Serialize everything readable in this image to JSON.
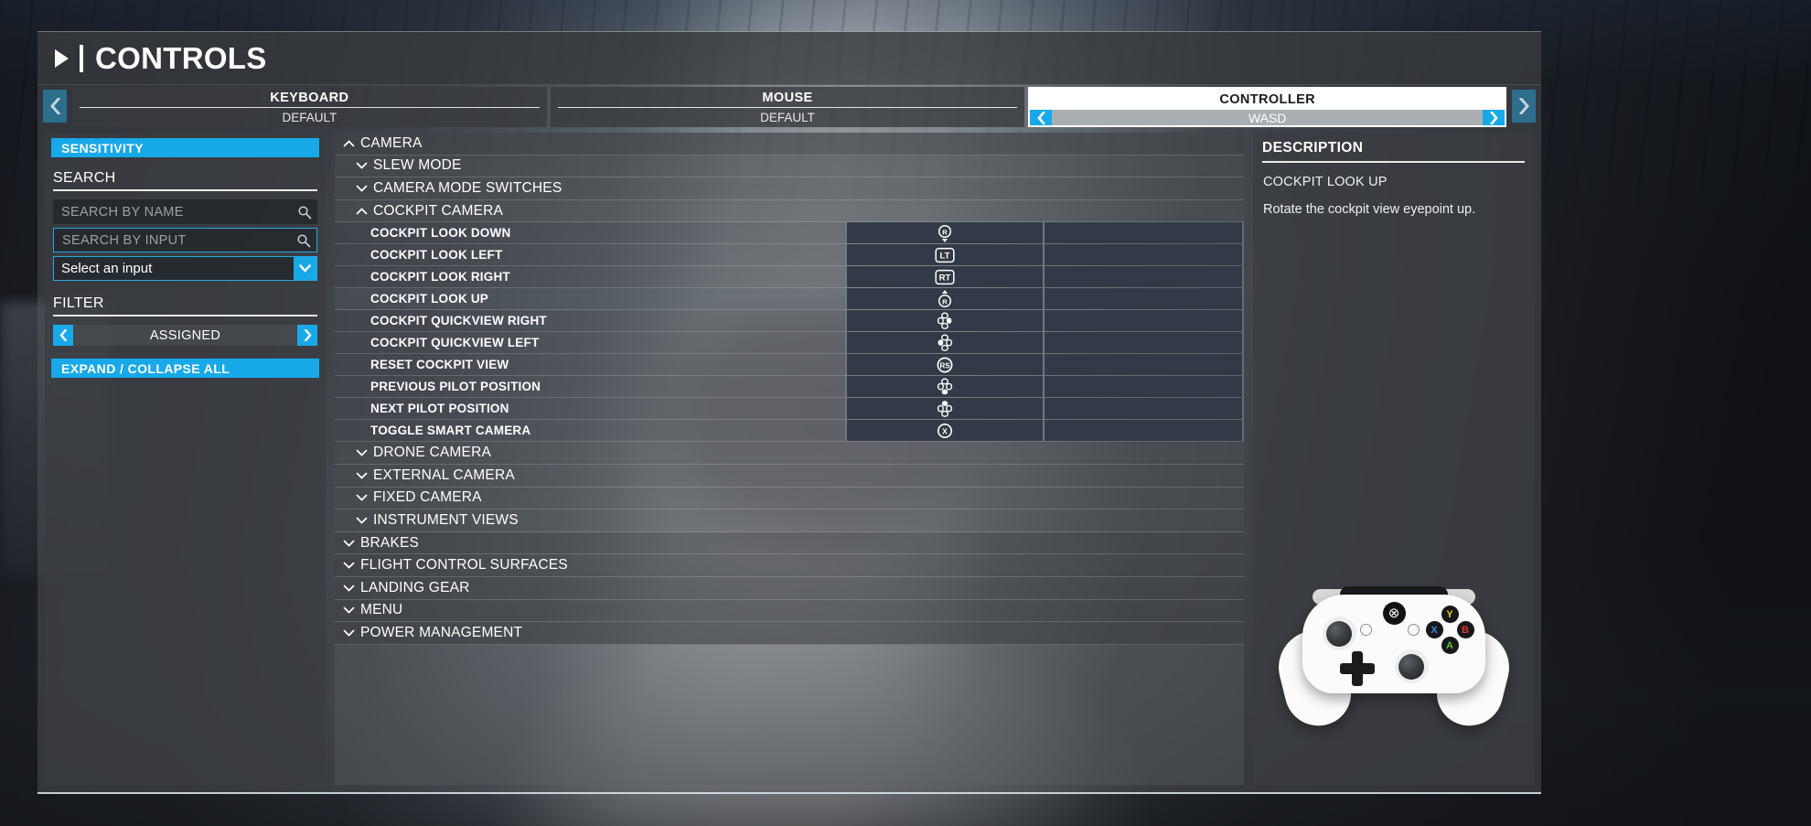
{
  "header": {
    "title": "CONTROLS",
    "arrow_icon": "chevron-right-icon",
    "nav_prev_icon": "chevron-left-icon",
    "nav_next_icon": "chevron-right-icon"
  },
  "tabs": [
    {
      "label": "KEYBOARD",
      "preset": "DEFAULT",
      "active": false
    },
    {
      "label": "MOUSE",
      "preset": "DEFAULT",
      "active": false
    },
    {
      "label": "CONTROLLER",
      "preset": "WASD",
      "active": true,
      "prev_icon": "chevron-left-icon",
      "next_icon": "chevron-right-icon"
    }
  ],
  "sidebar": {
    "sensitivity_label": "SENSITIVITY",
    "search": {
      "title": "SEARCH",
      "by_name_placeholder": "SEARCH BY NAME",
      "by_name_value": "",
      "by_input_placeholder": "SEARCH BY INPUT",
      "by_input_value": "",
      "select_input_value": "Select an input",
      "search_icon": "magnifier-icon",
      "caret_icon": "chevron-down-icon"
    },
    "filter": {
      "title": "FILTER",
      "value": "ASSIGNED",
      "prev_icon": "chevron-left-icon",
      "next_icon": "chevron-right-icon"
    },
    "expand_collapse_label": "EXPAND / COLLAPSE ALL"
  },
  "tree": [
    {
      "id": "camera",
      "label": "CAMERA",
      "level": 0,
      "type": "category",
      "expanded": true
    },
    {
      "id": "slew-mode",
      "label": "SLEW MODE",
      "level": 1,
      "type": "category",
      "expanded": false
    },
    {
      "id": "camera-mode-switches",
      "label": "CAMERA MODE SWITCHES",
      "level": 1,
      "type": "category",
      "expanded": false
    },
    {
      "id": "cockpit-camera",
      "label": "COCKPIT CAMERA",
      "level": 2,
      "type": "category",
      "expanded": true
    },
    {
      "id": "cockpit-look-down",
      "label": "COCKPIT LOOK DOWN",
      "type": "binding",
      "glyph": "rstick-down-icon",
      "selected": false
    },
    {
      "id": "cockpit-look-left",
      "label": "COCKPIT LOOK LEFT",
      "type": "binding",
      "glyph": "lt-trigger-icon",
      "selected": false
    },
    {
      "id": "cockpit-look-right",
      "label": "COCKPIT LOOK RIGHT",
      "type": "binding",
      "glyph": "rt-trigger-icon",
      "selected": false
    },
    {
      "id": "cockpit-look-up",
      "label": "COCKPIT LOOK UP",
      "type": "binding",
      "glyph": "rstick-up-icon",
      "selected": true
    },
    {
      "id": "cockpit-quickview-right",
      "label": "COCKPIT QUICKVIEW RIGHT",
      "type": "binding",
      "glyph": "dpad-right-icon",
      "selected": false
    },
    {
      "id": "cockpit-quickview-left",
      "label": "COCKPIT QUICKVIEW LEFT",
      "type": "binding",
      "glyph": "dpad-left-icon",
      "selected": false
    },
    {
      "id": "reset-cockpit-view",
      "label": "RESET COCKPIT VIEW",
      "type": "binding",
      "glyph": "rs-click-icon",
      "selected": false
    },
    {
      "id": "previous-pilot-position",
      "label": "PREVIOUS PILOT POSITION",
      "type": "binding",
      "glyph": "dpad-down-icon",
      "selected": false
    },
    {
      "id": "next-pilot-position",
      "label": "NEXT PILOT POSITION",
      "type": "binding",
      "glyph": "dpad-up-icon",
      "selected": false
    },
    {
      "id": "toggle-smart-camera",
      "label": "TOGGLE SMART CAMERA",
      "type": "binding",
      "glyph": "x-button-icon",
      "selected": false
    },
    {
      "id": "drone-camera",
      "label": "DRONE CAMERA",
      "level": 1,
      "type": "category",
      "expanded": false
    },
    {
      "id": "external-camera",
      "label": "EXTERNAL CAMERA",
      "level": 1,
      "type": "category",
      "expanded": false
    },
    {
      "id": "fixed-camera",
      "label": "FIXED CAMERA",
      "level": 1,
      "type": "category",
      "expanded": false
    },
    {
      "id": "instrument-views",
      "label": "INSTRUMENT VIEWS",
      "level": 1,
      "type": "category",
      "expanded": false
    },
    {
      "id": "brakes",
      "label": "BRAKES",
      "level": 0,
      "type": "category",
      "expanded": false
    },
    {
      "id": "flight-control-surfaces",
      "label": "FLIGHT CONTROL SURFACES",
      "level": 0,
      "type": "category",
      "expanded": false
    },
    {
      "id": "landing-gear",
      "label": "LANDING GEAR",
      "level": 0,
      "type": "category",
      "expanded": false
    },
    {
      "id": "menu",
      "label": "MENU",
      "level": 0,
      "type": "category",
      "expanded": false
    },
    {
      "id": "power-management",
      "label": "POWER MANAGEMENT",
      "level": 0,
      "type": "category",
      "expanded": false
    }
  ],
  "description": {
    "title": "DESCRIPTION",
    "binding_name": "COCKPIT LOOK UP",
    "text": "Rotate the cockpit view eyepoint up."
  },
  "controller": {
    "art_name": "xbox-controller-image",
    "buttons": {
      "y": "Y",
      "x": "X",
      "b": "B",
      "a": "A",
      "home": "⊗"
    }
  },
  "colors": {
    "accent_cyan": "#17a9e8",
    "nav_teal": "#2c6e8c",
    "bind_cell": "#333a47",
    "panel": "#3a3d41"
  }
}
